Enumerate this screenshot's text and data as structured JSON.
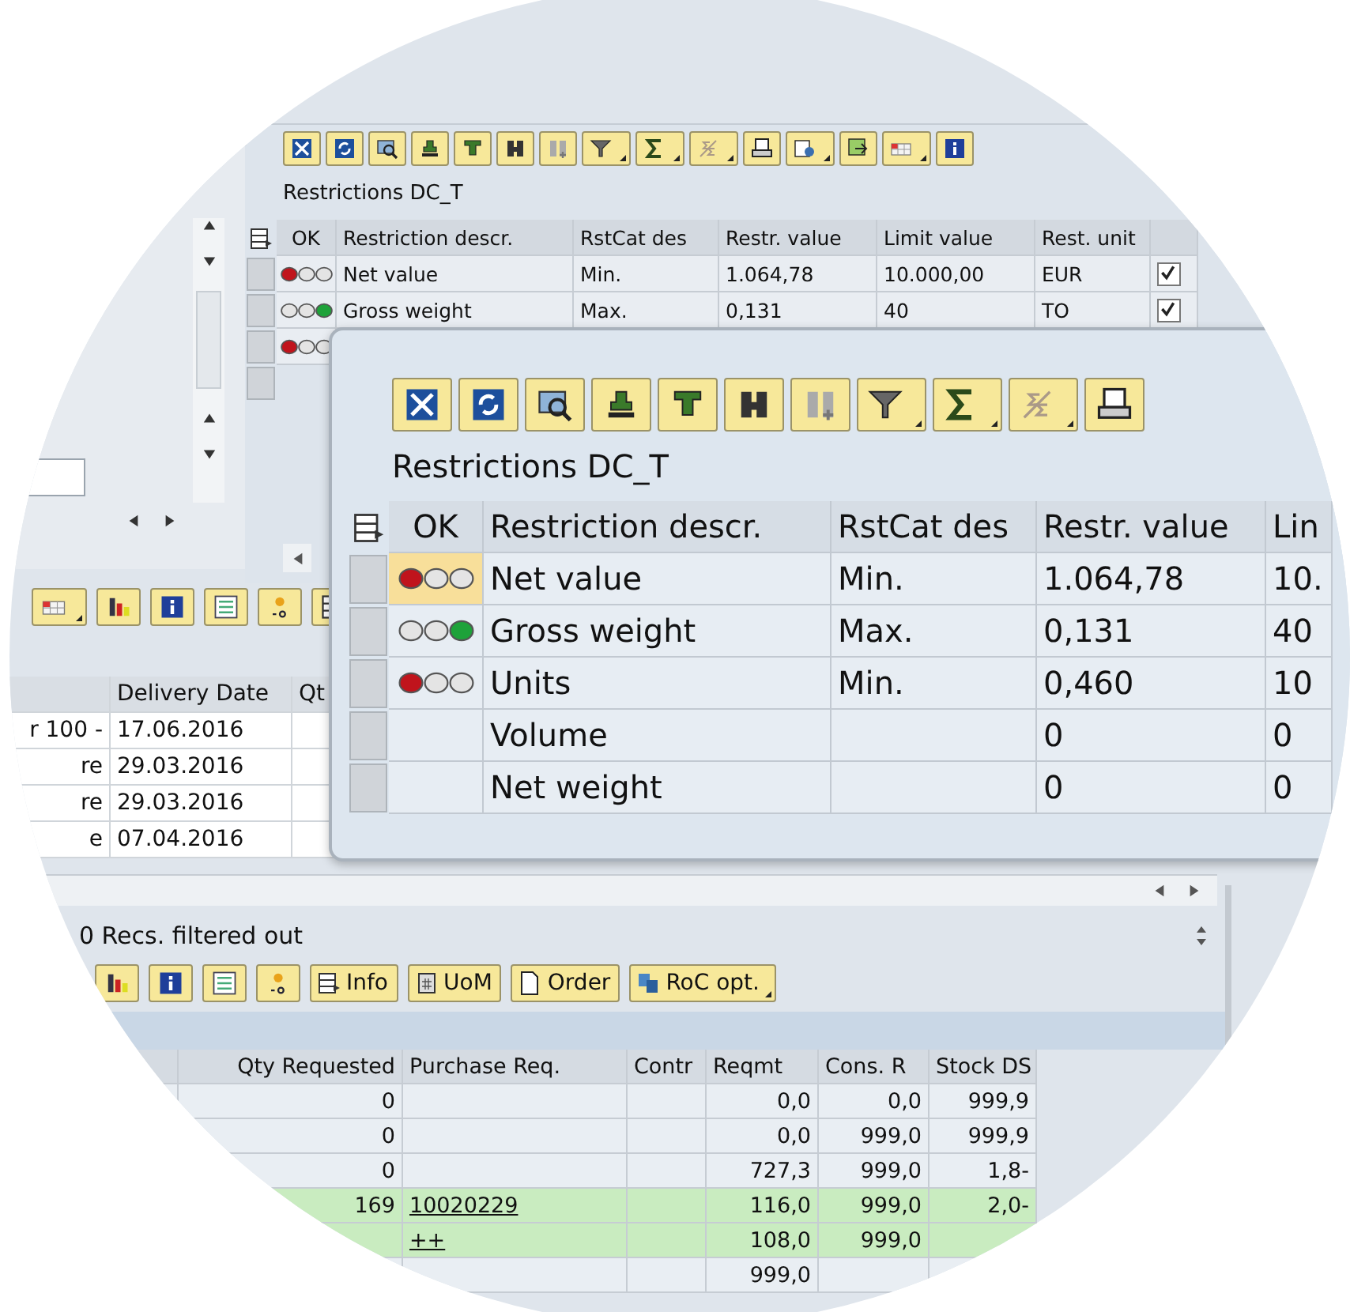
{
  "back_window": {
    "title": "Restrictions DC_T",
    "status_column": "OK",
    "columns": [
      "Restriction descr.",
      "RstCat des",
      "Restr. value",
      "Limit value",
      "Rest. unit"
    ],
    "rows": [
      {
        "red_lit": true,
        "green_lit": false,
        "checked": true,
        "cells": [
          "Net value",
          "Min.",
          "1.064,78",
          "10.000,00",
          "EUR"
        ]
      },
      {
        "red_lit": false,
        "green_lit": true,
        "checked": true,
        "cells": [
          "Gross weight",
          "Max.",
          "0,131",
          "40",
          "TO"
        ]
      }
    ],
    "partial_row": {
      "red_lit": true,
      "green_lit": false
    }
  },
  "middle_grid": {
    "columns": [
      "",
      "Delivery Date",
      "Qt"
    ],
    "rows": [
      {
        "cells": [
          "r 100 -",
          "17.06.2016"
        ]
      },
      {
        "cells": [
          "re",
          "29.03.2016"
        ]
      },
      {
        "cells": [
          "re",
          "29.03.2016"
        ]
      },
      {
        "cells": [
          "e",
          "07.04.2016"
        ]
      }
    ]
  },
  "status": "0 Recs. filtered out",
  "bottom_toolbar": [
    {
      "label": "Info",
      "dropdown": false
    },
    {
      "label": "UoM",
      "dropdown": false
    },
    {
      "label": "Order",
      "dropdown": false
    },
    {
      "label": "RoC opt.",
      "dropdown": true
    }
  ],
  "bottom_grid": {
    "columns": [
      "Qty Requested",
      "Purchase Req.",
      "Contr",
      "Reqmt",
      "Cons. R",
      "Stock DS"
    ],
    "rows": [
      {
        "highlighted": false,
        "cells": [
          "0",
          "",
          "",
          "0,0",
          "0,0",
          "999,9"
        ]
      },
      {
        "highlighted": false,
        "cells": [
          "0",
          "",
          "",
          "0,0",
          "999,0",
          "999,9"
        ]
      },
      {
        "highlighted": false,
        "cells": [
          "0",
          "",
          "",
          "727,3",
          "999,0",
          "1,8-"
        ]
      },
      {
        "highlighted": true,
        "cells": [
          "169",
          "10020229",
          "",
          "116,0",
          "999,0",
          "2,0-"
        ]
      },
      {
        "highlighted": true,
        "cells": [
          "",
          "++",
          "",
          "108,0",
          "999,0",
          ""
        ]
      },
      {
        "highlighted": false,
        "cells": [
          "",
          "",
          "",
          "999,0",
          "",
          ""
        ]
      }
    ]
  },
  "popup": {
    "title": "Restrictions DC_T",
    "status_column": "OK",
    "columns": [
      "Restriction descr.",
      "RstCat des",
      "Restr. value",
      "Lin"
    ],
    "rows": [
      {
        "red_lit": true,
        "green_lit": false,
        "selected": true,
        "cells": [
          "Net value",
          "Min.",
          "1.064,78",
          "10."
        ]
      },
      {
        "red_lit": false,
        "green_lit": true,
        "selected": false,
        "cells": [
          "Gross weight",
          "Max.",
          "0,131",
          "40"
        ]
      },
      {
        "red_lit": true,
        "green_lit": false,
        "selected": false,
        "cells": [
          "Units",
          "Min.",
          "0,460",
          "10"
        ]
      },
      {
        "red_lit": false,
        "green_lit": false,
        "selected": false,
        "cells": [
          "Volume",
          "",
          "0",
          "0"
        ]
      },
      {
        "red_lit": false,
        "green_lit": false,
        "selected": false,
        "cells": [
          "Net weight",
          "",
          "0",
          "0"
        ]
      }
    ]
  }
}
